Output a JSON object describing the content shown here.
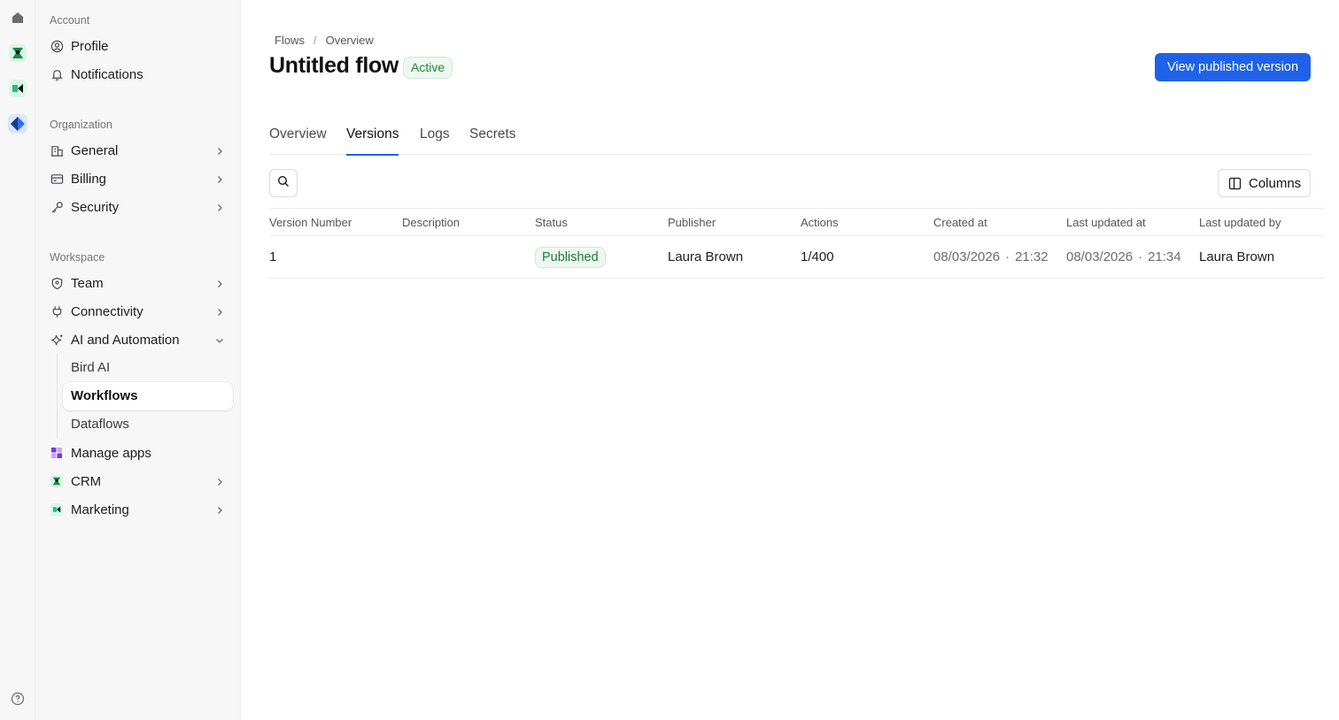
{
  "rail": {
    "icons": [
      "home-icon",
      "crm-app-icon",
      "marketing-app-icon",
      "bird-app-icon",
      "help-icon"
    ]
  },
  "sidebar": {
    "account": {
      "title": "Account",
      "items": [
        {
          "label": "Profile",
          "icon": "user-circle-icon"
        },
        {
          "label": "Notifications",
          "icon": "bell-icon"
        }
      ]
    },
    "organization": {
      "title": "Organization",
      "items": [
        {
          "label": "General",
          "icon": "building-icon"
        },
        {
          "label": "Billing",
          "icon": "credit-card-icon"
        },
        {
          "label": "Security",
          "icon": "key-icon"
        }
      ]
    },
    "workspace": {
      "title": "Workspace",
      "items": [
        {
          "label": "Team",
          "icon": "shield-icon"
        },
        {
          "label": "Connectivity",
          "icon": "plug-icon"
        },
        {
          "label": "AI and Automation",
          "icon": "sparkle-icon"
        },
        {
          "label": "Manage apps",
          "icon": "apps-icon"
        },
        {
          "label": "CRM",
          "icon": "crm-app-icon"
        },
        {
          "label": "Marketing",
          "icon": "marketing-app-icon"
        }
      ],
      "ai_subitems": [
        {
          "label": "Bird AI",
          "active": false
        },
        {
          "label": "Workflows",
          "active": true
        },
        {
          "label": "Dataflows",
          "active": false
        }
      ]
    }
  },
  "breadcrumb": {
    "first": "Flows",
    "separator": "/",
    "second": "Overview"
  },
  "header": {
    "title": "Untitled flow",
    "status": "Active",
    "primary_action": "View published version"
  },
  "tabs": [
    {
      "label": "Overview",
      "active": false
    },
    {
      "label": "Versions",
      "active": true
    },
    {
      "label": "Logs",
      "active": false
    },
    {
      "label": "Secrets",
      "active": false
    }
  ],
  "toolbar": {
    "columns_label": "Columns"
  },
  "table": {
    "columns": [
      "Version Number",
      "Description",
      "Status",
      "Publisher",
      "Actions",
      "Created at",
      "Last updated at",
      "Last updated by"
    ],
    "rows": [
      {
        "version": "1",
        "description": "",
        "status": "Published",
        "publisher": "Laura Brown",
        "actions": "1/400",
        "created_date": "08/03/2026",
        "created_time": "21:32",
        "updated_date": "08/03/2026",
        "updated_time": "21:34",
        "updated_by": "Laura Brown"
      }
    ],
    "dot": "·"
  },
  "colors": {
    "accent": "#1f62e8",
    "success": "#1f8a3b",
    "crm": "#1aa35a",
    "marketing": "#22c17a",
    "bird": "#2f6df6"
  }
}
